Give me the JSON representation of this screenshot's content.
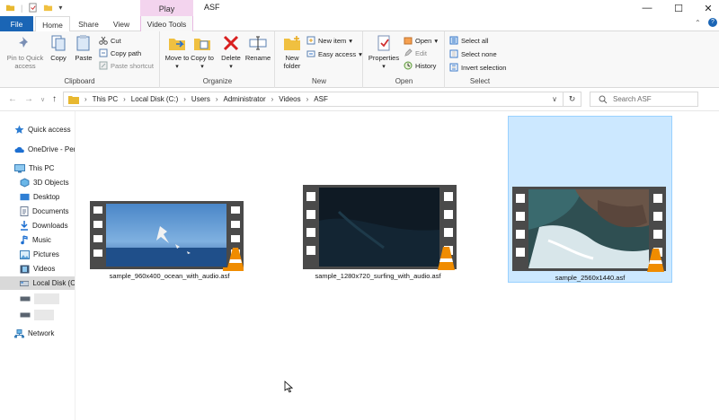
{
  "window": {
    "title": "ASF",
    "context_group": "Play"
  },
  "ribbon_tabs": [
    "File",
    "Home",
    "Share",
    "View",
    "Video Tools"
  ],
  "ribbon": {
    "clipboard": {
      "label": "Clipboard",
      "pin": "Pin to Quick access",
      "copy": "Copy",
      "paste": "Paste",
      "cut": "Cut",
      "copy_path": "Copy path",
      "paste_shortcut": "Paste shortcut"
    },
    "organize": {
      "label": "Organize",
      "move_to": "Move to",
      "copy_to": "Copy to",
      "delete": "Delete",
      "rename": "Rename"
    },
    "new": {
      "label": "New",
      "new_folder": "New folder",
      "new_item": "New item",
      "easy_access": "Easy access"
    },
    "open": {
      "label": "Open",
      "properties": "Properties",
      "open": "Open",
      "edit": "Edit",
      "history": "History"
    },
    "select": {
      "label": "Select",
      "select_all": "Select all",
      "select_none": "Select none",
      "invert": "Invert selection"
    }
  },
  "address": {
    "breadcrumb": [
      "This PC",
      "Local Disk (C:)",
      "Users",
      "Administrator",
      "Videos",
      "ASF"
    ],
    "search_placeholder": "Search ASF"
  },
  "nav": [
    {
      "label": "Quick access",
      "icon": "star-icon"
    },
    {
      "label": "OneDrive - Per",
      "icon": "cloud-icon"
    },
    {
      "label": "This PC",
      "icon": "monitor-icon"
    },
    {
      "label": "3D Objects",
      "icon": "cube-icon"
    },
    {
      "label": "Desktop",
      "icon": "desktop-icon"
    },
    {
      "label": "Documents",
      "icon": "documents-icon"
    },
    {
      "label": "Downloads",
      "icon": "download-icon"
    },
    {
      "label": "Music",
      "icon": "music-icon"
    },
    {
      "label": "Pictures",
      "icon": "pictures-icon"
    },
    {
      "label": "Videos",
      "icon": "videos-icon"
    },
    {
      "label": "Local Disk (C",
      "icon": "drive-icon"
    },
    {
      "label": "",
      "icon": "drive-icon"
    },
    {
      "label": "",
      "icon": "drive-icon"
    },
    {
      "label": "Network",
      "icon": "network-icon"
    }
  ],
  "files": [
    {
      "name": "sample_960x400_ocean_with_audio.asf",
      "selected": false
    },
    {
      "name": "sample_1280x720_surfing_with_audio.asf",
      "selected": false
    },
    {
      "name": "sample_2560x1440.asf",
      "selected": true
    }
  ],
  "colors": {
    "file_tab": "#1a65b5",
    "context_tab": "#f3d4ee",
    "selection_fill": "#cce8ff",
    "selection_border": "#99d1ff"
  }
}
